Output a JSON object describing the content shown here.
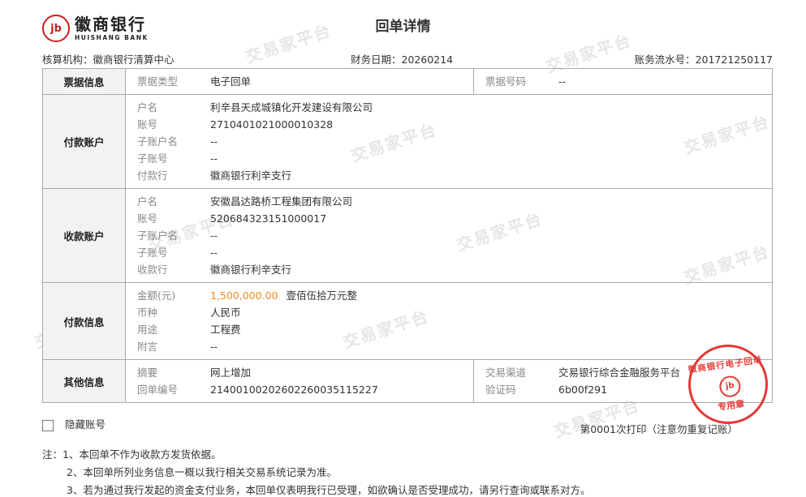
{
  "header": {
    "logo_mark": "jb",
    "bank_name_cn": "徽商银行",
    "bank_name_en": "HUISHANG BANK",
    "title": "回单详情"
  },
  "meta": {
    "org": "核算机构：徽商银行清算中心",
    "date": "财务日期：20260214",
    "serial": "账务流水号：201721250117"
  },
  "watermark": {
    "text": "交易家平台"
  },
  "sections": {
    "ticket": {
      "label": "票据信息",
      "type_label": "票据类型",
      "type_value": "电子回单",
      "no_label": "票据号码",
      "no_value": "--"
    },
    "payer": {
      "label": "付款账户",
      "rows": [
        {
          "k": "户名",
          "v": "利辛县天成城镇化开发建设有限公司"
        },
        {
          "k": "账号",
          "v": "2710401021000010328"
        },
        {
          "k": "子账户名",
          "v": "--"
        },
        {
          "k": "子账号",
          "v": "--"
        },
        {
          "k": "付款行",
          "v": "徽商银行利辛支行"
        }
      ]
    },
    "payee": {
      "label": "收款账户",
      "rows": [
        {
          "k": "户名",
          "v": "安徽昌达路桥工程集团有限公司"
        },
        {
          "k": "账号",
          "v": "520684323151000017"
        },
        {
          "k": "子账户名",
          "v": "--"
        },
        {
          "k": "子账号",
          "v": "--"
        },
        {
          "k": "收款行",
          "v": "徽商银行利辛支行"
        }
      ]
    },
    "payment": {
      "label": "付款信息",
      "amount_label": "金额(元)",
      "amount_value": "1,500,000.00",
      "amount_words": "壹佰伍拾万元整",
      "rows": [
        {
          "k": "币种",
          "v": "人民币"
        },
        {
          "k": "用途",
          "v": "工程费"
        },
        {
          "k": "附言",
          "v": "--"
        }
      ]
    },
    "other": {
      "label": "其他信息",
      "summary_label": "摘要",
      "summary_value": "网上增加",
      "receipt_label": "回单编号",
      "receipt_value": "21400100202602260035115227",
      "channel_label": "交易渠道",
      "channel_value": "交易银行综合金融服务平台",
      "code_label": "验证码",
      "code_value": "6b00f291"
    }
  },
  "hide_account_label": "隐藏账号",
  "print_info": "第0001次打印（注意勿重复记账）",
  "notes": [
    "注：1、本回单不作为收款方发货依据。",
    "2、本回单所列业务信息一概以我行相关交易系统记录为准。",
    "3、若为通过我行发起的资金支付业务，本回单仅表明我行已受理，如欲确认是否受理成功，请另行查询或联系对方。"
  ],
  "stamp": {
    "top": "徽商银行电子回单",
    "bottom": "专用章",
    "logo": "jb"
  },
  "colors": {
    "stamp": "#e53935",
    "amount": "#f08a24",
    "logo": "#c9201f"
  }
}
